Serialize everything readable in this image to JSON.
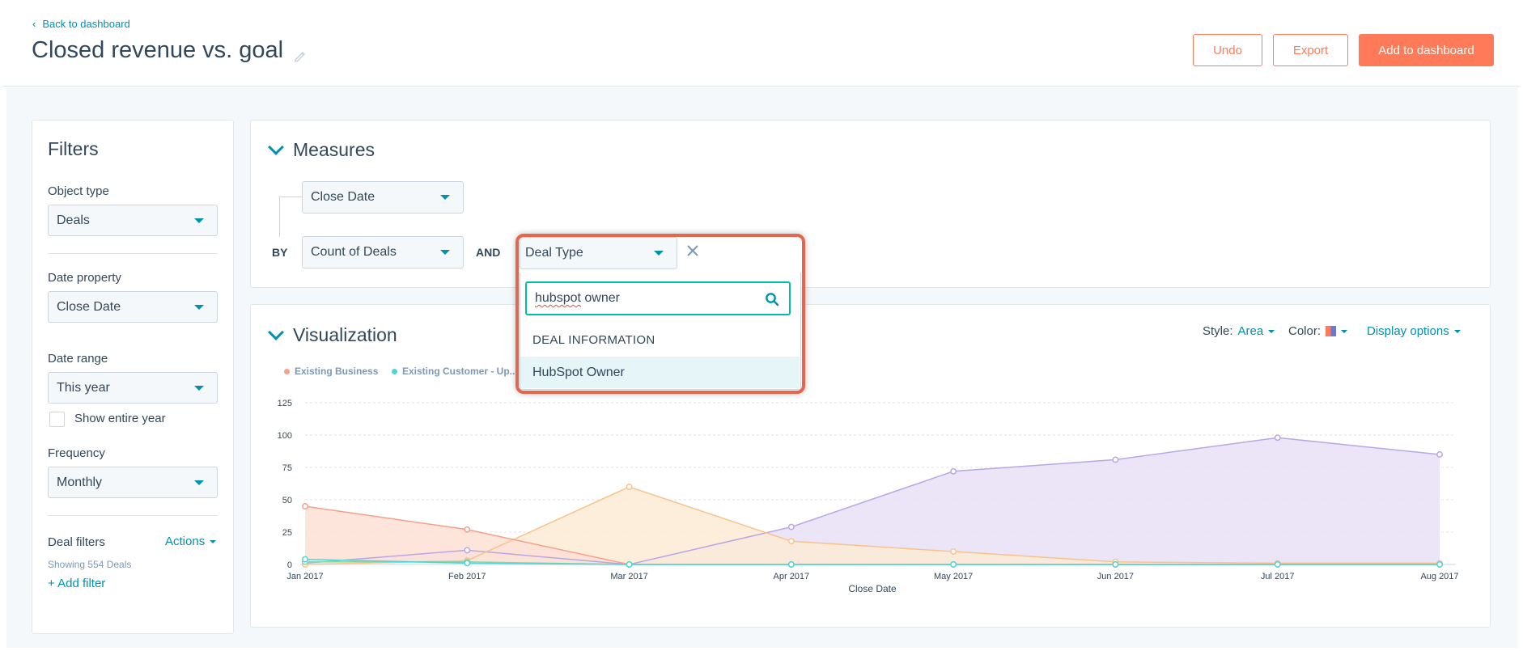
{
  "header": {
    "back_label": "Back to dashboard",
    "title": "Closed revenue vs. goal",
    "undo": "Undo",
    "export": "Export",
    "add_to_dashboard": "Add to dashboard"
  },
  "filters": {
    "title": "Filters",
    "object_type_label": "Object type",
    "object_type_value": "Deals",
    "date_property_label": "Date property",
    "date_property_value": "Close Date",
    "date_range_label": "Date range",
    "date_range_value": "This year",
    "show_entire_year": "Show entire year",
    "frequency_label": "Frequency",
    "frequency_value": "Monthly",
    "deal_filters_label": "Deal filters",
    "actions_label": "Actions",
    "showing": "Showing 554 Deals",
    "add_filter": "+ Add filter"
  },
  "measures": {
    "title": "Measures",
    "top_select": "Close Date",
    "by_label": "BY",
    "count_select": "Count of Deals",
    "and_label": "AND",
    "deal_type_select": "Deal Type"
  },
  "dropdown": {
    "search_value_misspelled": "hubspot",
    "search_value_rest": " owner",
    "group_heading": "DEAL INFORMATION",
    "option": "HubSpot Owner"
  },
  "visualization": {
    "title": "Visualization",
    "style_label": "Style:",
    "style_value": "Area",
    "color_label": "Color:",
    "display_options": "Display options"
  },
  "colors": {
    "accent": "#ff7a59",
    "link": "#0091ae",
    "teal": "#00bda5",
    "highlight": "#e6654d"
  },
  "chart_data": {
    "type": "area",
    "x": [
      "Jan 2017",
      "Feb 2017",
      "Mar 2017",
      "Apr 2017",
      "May 2017",
      "Jun 2017",
      "Jul 2017",
      "Aug 2017"
    ],
    "xlabel": "Close Date",
    "ylabel": "",
    "ylim": [
      0,
      125
    ],
    "yticks": [
      0,
      25,
      50,
      75,
      100,
      125
    ],
    "grid": true,
    "legend_position": "top-left",
    "series": [
      {
        "name": "Existing Business",
        "color": "#f5a08a",
        "fill": "#fde0d6",
        "values": [
          45,
          27,
          0,
          0,
          0,
          0,
          0,
          0
        ]
      },
      {
        "name": "Existing Customer - Up...",
        "color": "#51d3d9",
        "fill": "#daf5f6",
        "values": [
          4,
          1,
          0,
          0,
          0,
          0,
          0,
          0
        ]
      },
      {
        "name": "",
        "color": "#f8c38a",
        "fill": "#fdebd6",
        "values": [
          0,
          3,
          60,
          18,
          10,
          2,
          1,
          1
        ]
      },
      {
        "name": "",
        "color": "#b9a7e4",
        "fill": "#e7e0f6",
        "values": [
          1,
          11,
          0,
          29,
          72,
          81,
          98,
          85
        ]
      },
      {
        "name": "",
        "color": "#8fd3a5",
        "fill": "#e1f4e7",
        "values": [
          2,
          2,
          0,
          0,
          0,
          0,
          0,
          0
        ]
      }
    ]
  }
}
